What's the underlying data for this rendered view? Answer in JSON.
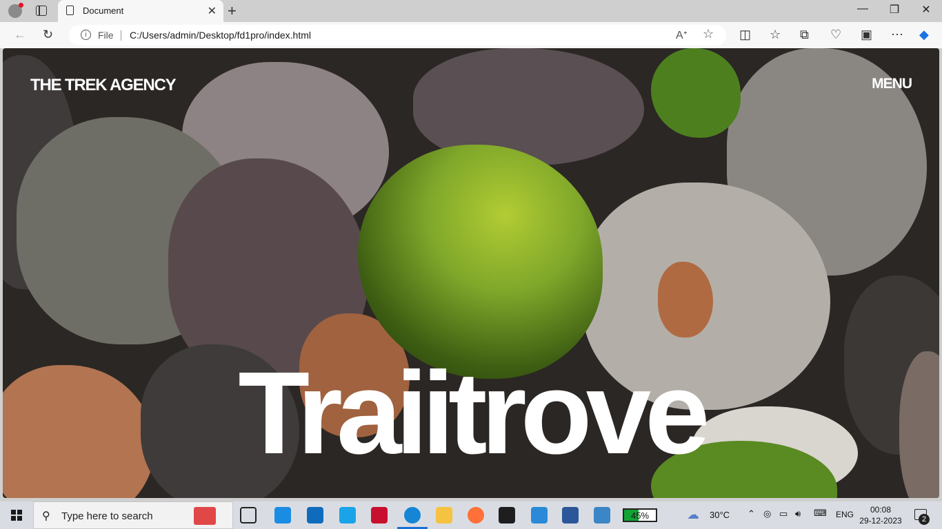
{
  "browser": {
    "tab_title": "Document",
    "address_scheme": "File",
    "address_url": "C:/Users/admin/Desktop/fd1pro/index.html"
  },
  "site": {
    "logo": "THE TREK AGENCY",
    "menu": "MENU",
    "hero_title": "Traiitrove"
  },
  "taskbar": {
    "search_placeholder": "Type here to search",
    "battery_percent": "45%",
    "battery_level": 0.45,
    "temperature": "30°C",
    "language": "ENG",
    "time": "00:08",
    "date": "29-12-2023",
    "notification_count": "2"
  },
  "colors": {
    "moss": "#7fa72a",
    "tab_active": "#f7f7f7",
    "battery": "#12a335"
  }
}
